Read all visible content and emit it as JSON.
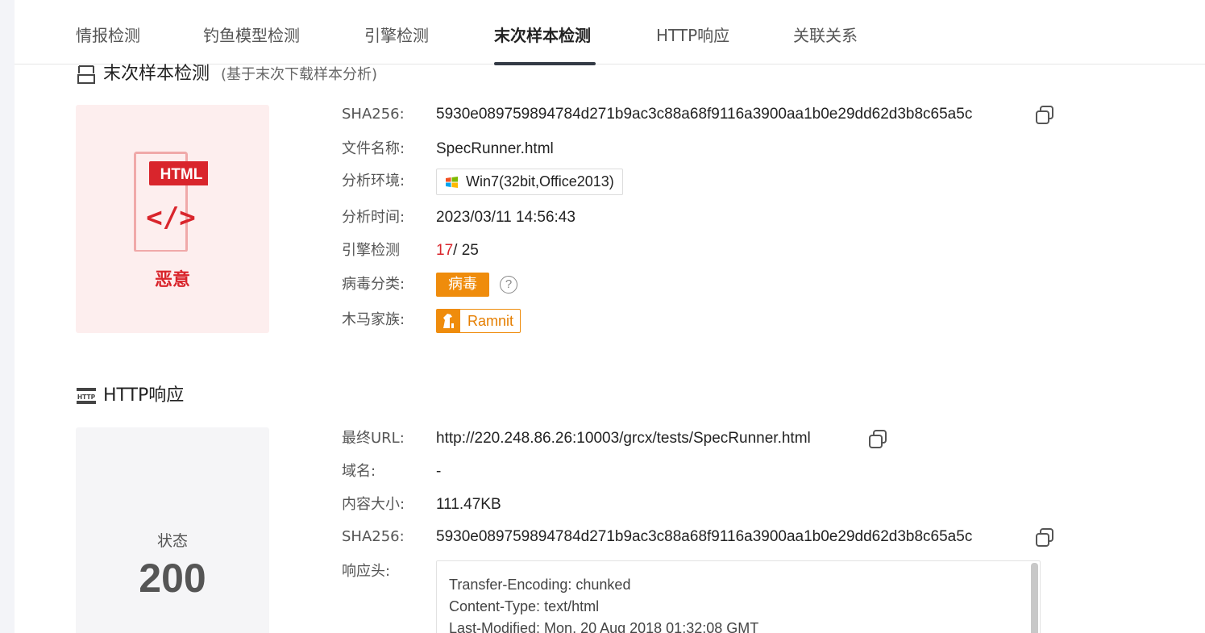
{
  "tabs": [
    {
      "label": "情报检测"
    },
    {
      "label": "钓鱼模型检测"
    },
    {
      "label": "引擎检测"
    },
    {
      "label": "末次样本检测"
    },
    {
      "label": "HTTP响应"
    },
    {
      "label": "关联关系"
    }
  ],
  "active_tab": "末次样本检测",
  "sample_section": {
    "title": "末次样本检测",
    "subtitle": "(基于末次下载样本分析)",
    "file_type": "HTML",
    "file_glyph": "</>",
    "verdict": "恶意",
    "sha256_label": "SHA256:",
    "sha256": "5930e089759894784d271b9ac3c88a68f9116a3900aa1b0e29dd62d3b8c65a5c",
    "filename_label": "文件名称:",
    "filename": "SpecRunner.html",
    "env_label": "分析环境:",
    "env": "Win7(32bit,Office2013)",
    "time_label": "分析时间:",
    "time": "2023/03/11 14:56:43",
    "engine_label": "引擎检测",
    "engine_hits": "17",
    "engine_total": "/ 25",
    "category_label": "病毒分类:",
    "category": "病毒",
    "help_glyph": "?",
    "family_label": "木马家族:",
    "family": "Ramnit"
  },
  "http_section": {
    "title": "HTTP响应",
    "icon_text": "HTTP",
    "status_label": "状态",
    "status_code": "200",
    "url_label": "最终URL:",
    "url": "http://220.248.86.26:10003/grcx/tests/SpecRunner.html",
    "domain_label": "域名:",
    "domain": "-",
    "size_label": "内容大小:",
    "size": "111.47KB",
    "sha256_label": "SHA256:",
    "sha256": "5930e089759894784d271b9ac3c88a68f9116a3900aa1b0e29dd62d3b8c65a5c",
    "headers_label": "响应头:",
    "headers": [
      "Transfer-Encoding: chunked",
      "Content-Type: text/html",
      "Last-Modified: Mon, 20 Aug 2018 01:32:08 GMT"
    ]
  },
  "colors": {
    "malicious_red": "#d9252c",
    "virus_orange": "#ef8c0c",
    "tab_underline": "#333a45"
  }
}
